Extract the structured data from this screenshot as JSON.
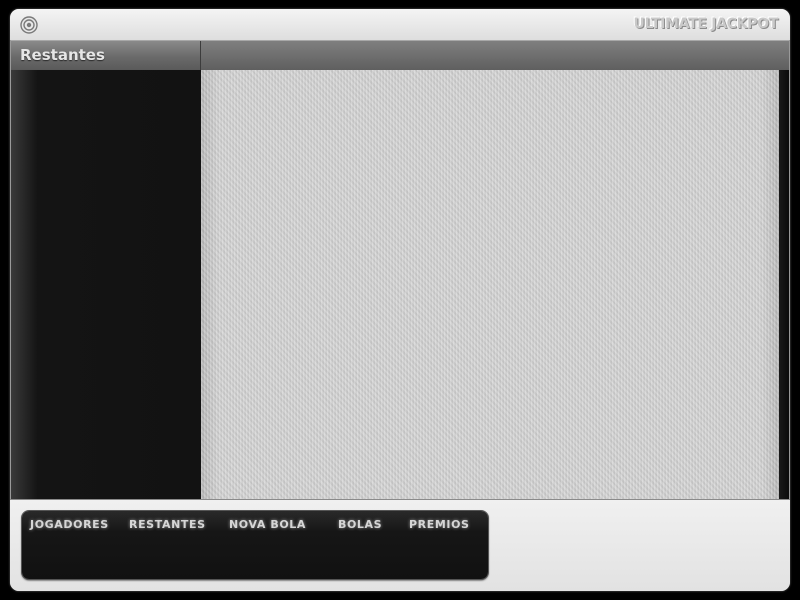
{
  "window": {
    "title": "ULTIMATE JACKPOT",
    "logo_icon": "target-ring-icon"
  },
  "section": {
    "header_label": "Restantes"
  },
  "nav": {
    "items": [
      {
        "id": "jogadores",
        "label": "JOGADORES"
      },
      {
        "id": "restantes",
        "label": "RESTANTES"
      },
      {
        "id": "novabola",
        "label": "NOVA BOLA"
      },
      {
        "id": "bolas",
        "label": "BOLAS"
      },
      {
        "id": "premios",
        "label": "PREMIOS"
      }
    ]
  },
  "colors": {
    "window_frame": "#e6e6e6",
    "header_bar": "#6e6e6e",
    "left_panel": "#121212",
    "content_panel": "#cfcfcf",
    "nav_panel": "#151515",
    "nav_text": "#d6d6d6"
  }
}
